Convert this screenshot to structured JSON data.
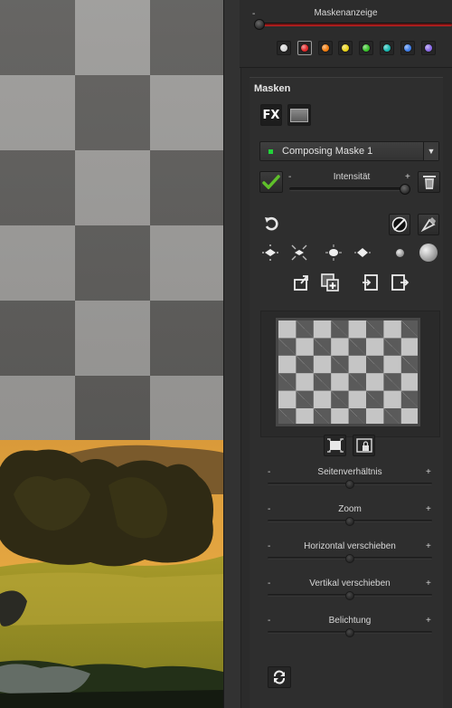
{
  "mask_display": {
    "title": "Maskenanzeige",
    "minus": "-",
    "colors": [
      "#d6d6d6",
      "#e02a2a",
      "#f07d10",
      "#e8d21a",
      "#39c12c",
      "#19b8b0",
      "#3f7ee8",
      "#8a6ae6"
    ]
  },
  "masks": {
    "title": "Masken",
    "fx_label": "FX",
    "dropdown": {
      "value": "Composing Maske 1",
      "arrow": "▼"
    },
    "intensity": {
      "label": "Intensität",
      "minus": "-",
      "plus": "+",
      "value": 0.97
    }
  },
  "sliders": [
    {
      "label": "Seitenverhältnis",
      "minus": "-",
      "plus": "+",
      "value": 0.5
    },
    {
      "label": "Zoom",
      "minus": "-",
      "plus": "+",
      "value": 0.5
    },
    {
      "label": "Horizontal verschieben",
      "minus": "-",
      "plus": "+",
      "value": 0.5
    },
    {
      "label": "Vertikal verschieben",
      "minus": "-",
      "plus": "+",
      "value": 0.5
    },
    {
      "label": "Belichtung",
      "minus": "-",
      "plus": "+",
      "value": 0.5
    }
  ],
  "icons": {
    "fx": "fx-button",
    "landscape": "landscape-mask-icon",
    "apply": "checkmark-icon",
    "delete": "trash-icon",
    "undo": "undo-icon",
    "invert": "invert-mask-icon",
    "brush": "brush-icon",
    "refresh": "refresh-icon"
  }
}
